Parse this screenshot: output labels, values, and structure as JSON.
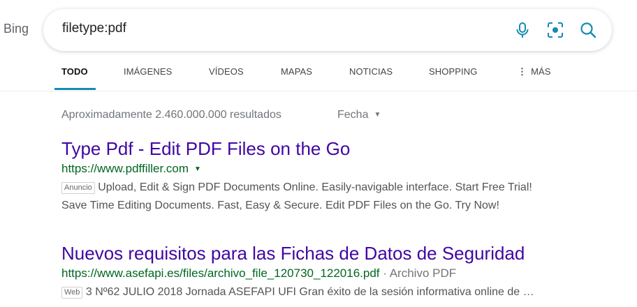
{
  "header": {
    "logo_text": "Bing",
    "search": {
      "query": "filetype:pdf",
      "icons": [
        "microphone-icon",
        "visual-search-icon",
        "search-icon"
      ]
    }
  },
  "tabs": [
    {
      "label": "TODO",
      "active": true
    },
    {
      "label": "IMÁGENES",
      "active": false
    },
    {
      "label": "VÍDEOS",
      "active": false
    },
    {
      "label": "MAPAS",
      "active": false
    },
    {
      "label": "NOTICIAS",
      "active": false
    },
    {
      "label": "SHOPPING",
      "active": false
    },
    {
      "label": "MÁS",
      "active": false
    }
  ],
  "results_info": {
    "count_text": "Aproximadamente 2.460.000.000 resultados",
    "date_filter_label": "Fecha"
  },
  "results": [
    {
      "title": "Type Pdf - Edit PDF Files on the Go",
      "url": "https://www.pdffiller.com",
      "badge": "Anuncio",
      "snippet_line1": "Upload, Edit & Sign PDF Documents Online. Easily-navigable interface. Start Free Trial!",
      "snippet_line2": "Save Time Editing Documents. Fast, Easy & Secure. Edit PDF Files on the Go. Try Now!"
    },
    {
      "title": "Nuevos requisitos para las Fichas de Datos de Seguridad",
      "url": "https://www.asefapi.es/files/archivo_file_120730_122016.pdf",
      "file_type": "· Archivo PDF",
      "badge": "Web",
      "snippet_line1": "3 Nº62 JULIO 2018 Jornada ASEFAPI UFI Gran éxito de la sesión informativa online de …"
    }
  ],
  "colors": {
    "link_title": "#4007a2",
    "url_green": "#006621",
    "accent": "#178ab4"
  }
}
